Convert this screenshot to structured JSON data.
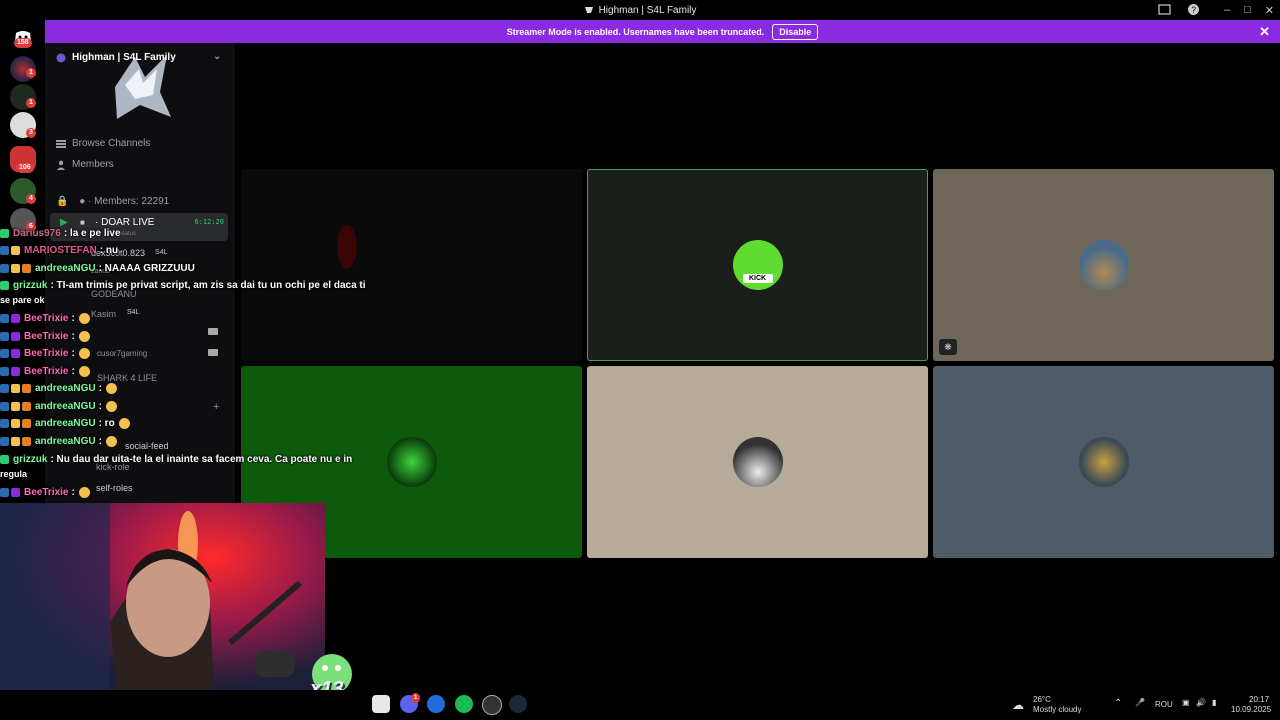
{
  "window": {
    "title": "Highman | S4L Family"
  },
  "banner": {
    "text": "Streamer Mode is enabled. Usernames have been truncated.",
    "button": "Disable"
  },
  "guild_badges": [
    "158",
    "1",
    "1",
    "3",
    "106",
    "4",
    "6"
  ],
  "server": {
    "name": "Highman | S4L Family",
    "browse_channels": "Browse Channels",
    "members_nav": "Members",
    "members_count": "Members: 22291",
    "live_channel": "DOAR LIVE",
    "live_time": "6:12:20",
    "live_status": "status"
  },
  "sidebar_ghost": {
    "user1": "dex3c0t0.823",
    "tag1": "S4L",
    "user2": "zanub",
    "user3": "GODEANU",
    "user4": "Kasim",
    "tag4": "S4L",
    "user5": "cusor7gaming",
    "channel1": "SHARK 4 LIFE",
    "channel2": "social-feed",
    "channel2_badge": "206",
    "channel3": "kick-role",
    "channel4": "self-roles"
  },
  "chat": [
    {
      "user": "Darius976",
      "text": ": la e pe live"
    },
    {
      "user": "MARIOSTEFAN",
      "text": ": nu"
    },
    {
      "user": "andreeaNGU",
      "text": ": NAAAA GRIZZUUU"
    },
    {
      "user": "grizzuk",
      "text": ": TI-am trimis pe privat script, am zis sa dai tu un ochi pe el daca ti"
    },
    {
      "user": "BeeTrixie",
      "text": ":"
    },
    {
      "user": "BeeTrixie",
      "text": ":"
    },
    {
      "user": "BeeTrixie",
      "text": ":"
    },
    {
      "user": "BeeTrixie",
      "text": ":"
    },
    {
      "user": "andreeaNGU",
      "text": ":"
    },
    {
      "user": "andreeaNGU",
      "text": ":"
    },
    {
      "user": "andreeaNGU",
      "text": ": ro"
    },
    {
      "user": "andreeaNGU",
      "text": ":"
    },
    {
      "user": "grizzuk",
      "text": ": Nu dau dar uita-te la el inainte sa facem ceva. Ca poate nu e in"
    },
    {
      "user": "BeeTrixie",
      "text": ":"
    }
  ],
  "chat_wraps": {
    "w1": "se pare ok",
    "w2": "regula"
  },
  "overlay": {
    "pet_label": "x13"
  },
  "tiles": [
    {
      "bg": "#0f0f0f",
      "avatar": "none"
    },
    {
      "bg": "#1a1d1a",
      "avatar": "kick",
      "label": "KICK"
    },
    {
      "bg": "#6e6658",
      "avatar": "pyramids"
    },
    {
      "bg": "#0d5a0d",
      "avatar": "green-orb"
    },
    {
      "bg": "#b6aa98",
      "avatar": "car"
    },
    {
      "bg": "#4d5c66",
      "avatar": "duck"
    }
  ],
  "taskbar": {
    "temperature": "26°C",
    "weather": "Mostly cloudy",
    "lang": "ROU",
    "time": "20:17",
    "date": "10.09.2025",
    "notif_badge": "1"
  }
}
